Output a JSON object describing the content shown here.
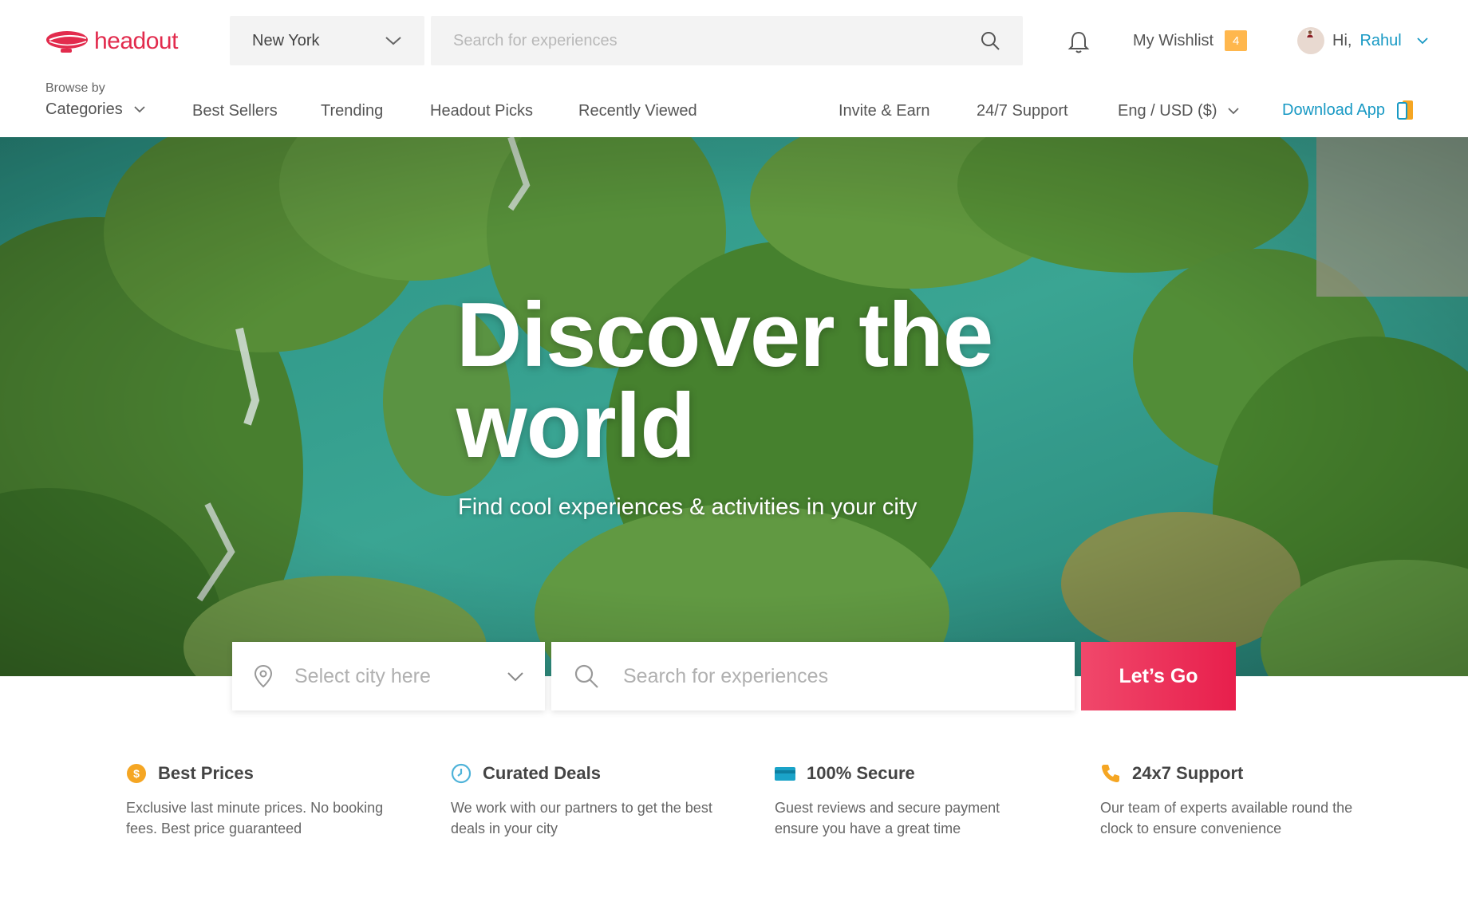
{
  "header": {
    "logo_text": "headout",
    "city": "New York",
    "search_placeholder": "Search for experiences",
    "wishlist_label": "My Wishlist",
    "wishlist_count": "4",
    "greeting": "Hi,",
    "user_name": "Rahul"
  },
  "nav": {
    "browse_small": "Browse by",
    "browse_label": "Categories",
    "links": [
      "Best Sellers",
      "Trending",
      "Headout Picks",
      "Recently Viewed"
    ],
    "invite": "Invite & Earn",
    "support": "24/7 Support",
    "language": "Eng / USD ($)",
    "download": "Download App"
  },
  "hero": {
    "title": "Discover the world",
    "subtitle": "Find cool experiences & activities in your city"
  },
  "search": {
    "city_placeholder": "Select city here",
    "search_placeholder": "Search for experiences",
    "button_label": "Let’s Go"
  },
  "features": [
    {
      "icon": "coin-icon",
      "color": "#f5a623",
      "title": "Best Prices",
      "desc": "Exclusive last minute prices. No booking fees. Best price guaranteed"
    },
    {
      "icon": "clock-icon",
      "color": "#4fb3d9",
      "title": "Curated Deals",
      "desc": "We work with our partners to get the best deals in your city"
    },
    {
      "icon": "credit-card-icon",
      "color": "#1aa3c8",
      "title": "100% Secure",
      "desc": "Guest reviews and secure payment ensure you have a great time"
    },
    {
      "icon": "phone-icon",
      "color": "#f5a623",
      "title": "24x7 Support",
      "desc": "Our team of experts available round the clock to ensure convenience"
    }
  ],
  "colors": {
    "brand": "#e22b4d",
    "link": "#1899c4",
    "badge": "#ffb74d",
    "cta": "#e81f4c"
  }
}
